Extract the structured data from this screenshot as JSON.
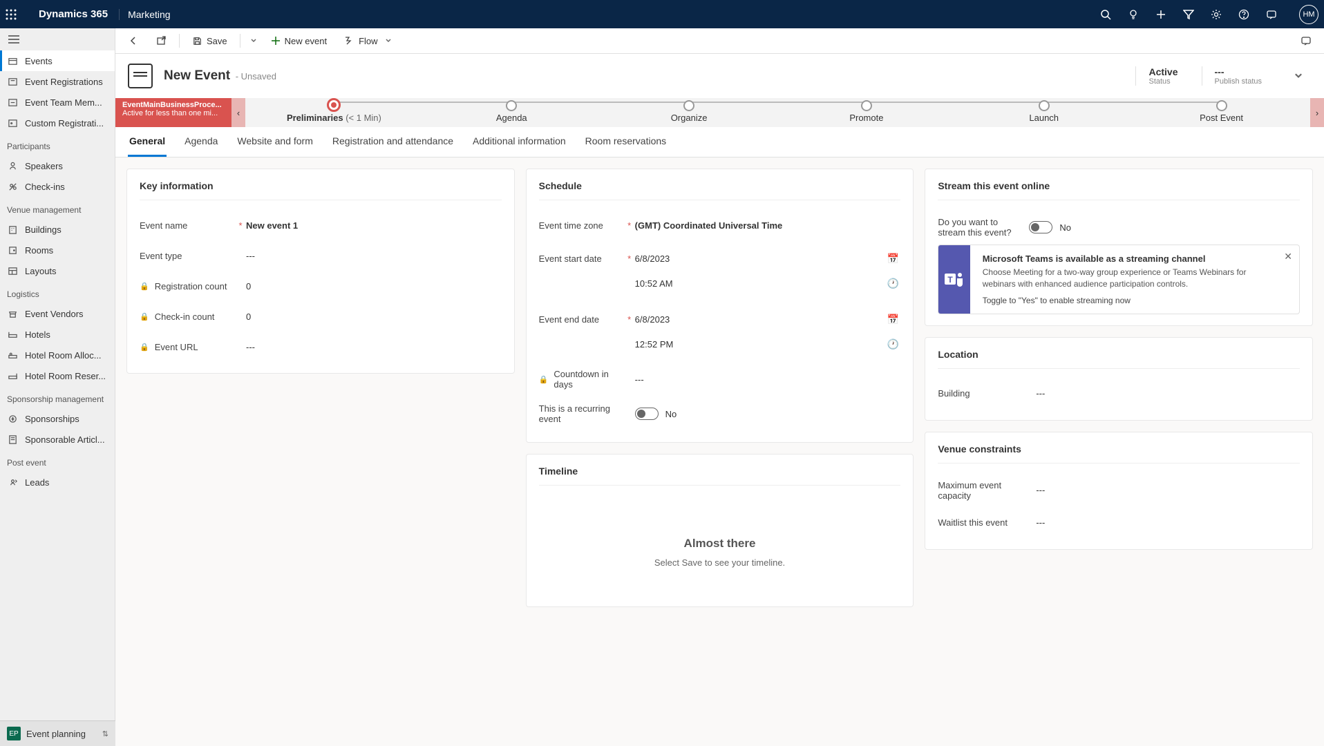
{
  "topbar": {
    "brand": "Dynamics 365",
    "appname": "Marketing",
    "avatar": "HM"
  },
  "sidebar": {
    "items": [
      {
        "label": "Events",
        "active": true
      },
      {
        "label": "Event Registrations"
      },
      {
        "label": "Event Team Mem..."
      },
      {
        "label": "Custom Registrati..."
      }
    ],
    "sections": [
      {
        "label": "Participants",
        "items": [
          {
            "label": "Speakers"
          },
          {
            "label": "Check-ins"
          }
        ]
      },
      {
        "label": "Venue management",
        "items": [
          {
            "label": "Buildings"
          },
          {
            "label": "Rooms"
          },
          {
            "label": "Layouts"
          }
        ]
      },
      {
        "label": "Logistics",
        "items": [
          {
            "label": "Event Vendors"
          },
          {
            "label": "Hotels"
          },
          {
            "label": "Hotel Room Alloc..."
          },
          {
            "label": "Hotel Room Reser..."
          }
        ]
      },
      {
        "label": "Sponsorship management",
        "items": [
          {
            "label": "Sponsorships"
          },
          {
            "label": "Sponsorable Articl..."
          }
        ]
      },
      {
        "label": "Post event",
        "items": [
          {
            "label": "Leads"
          }
        ]
      }
    ],
    "switcher": {
      "badge": "EP",
      "label": "Event planning"
    }
  },
  "cmdbar": {
    "save": "Save",
    "new_event": "New event",
    "flow": "Flow"
  },
  "header": {
    "title": "New Event",
    "unsaved": "- Unsaved",
    "status_value": "Active",
    "status_label": "Status",
    "publish_value": "---",
    "publish_label": "Publish status"
  },
  "bpf": {
    "name": "EventMainBusinessProce...",
    "sub": "Active for less than one mi...",
    "stages": [
      "Preliminaries",
      "Agenda",
      "Organize",
      "Promote",
      "Launch",
      "Post Event"
    ],
    "stage_time": "(< 1 Min)"
  },
  "tabs": [
    "General",
    "Agenda",
    "Website and form",
    "Registration and attendance",
    "Additional information",
    "Room reservations"
  ],
  "form": {
    "keyinfo": {
      "title": "Key information",
      "event_name_label": "Event name",
      "event_name_value": "New event 1",
      "event_type_label": "Event type",
      "event_type_value": "---",
      "reg_count_label": "Registration count",
      "reg_count_value": "0",
      "checkin_count_label": "Check-in count",
      "checkin_count_value": "0",
      "event_url_label": "Event URL",
      "event_url_value": "---"
    },
    "schedule": {
      "title": "Schedule",
      "tz_label": "Event time zone",
      "tz_value": "(GMT) Coordinated Universal Time",
      "start_label": "Event start date",
      "start_date": "6/8/2023",
      "start_time": "10:52 AM",
      "end_label": "Event end date",
      "end_date": "6/8/2023",
      "end_time": "12:52 PM",
      "countdown_label": "Countdown in days",
      "countdown_value": "---",
      "recurring_label": "This is a recurring event",
      "recurring_value": "No"
    },
    "timeline": {
      "title": "Timeline",
      "empty_title": "Almost there",
      "empty_desc": "Select Save to see your timeline."
    },
    "stream": {
      "title": "Stream this event online",
      "prompt": "Do you want to stream this event?",
      "value": "No",
      "banner_title": "Microsoft Teams is available as a streaming channel",
      "banner_desc": "Choose Meeting for a two-way group experience or Teams Webinars for webinars with enhanced audience participation controls.",
      "banner_action": "Toggle to \"Yes\" to enable streaming now"
    },
    "location": {
      "title": "Location",
      "building_label": "Building",
      "building_value": "---"
    },
    "venue": {
      "title": "Venue constraints",
      "maxcap_label": "Maximum event capacity",
      "maxcap_value": "---",
      "waitlist_label": "Waitlist this event",
      "waitlist_value": "---"
    }
  }
}
